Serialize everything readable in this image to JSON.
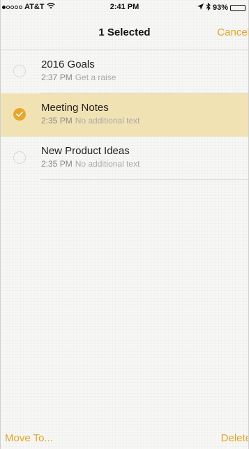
{
  "status_bar": {
    "carrier": "AT&T",
    "time": "2:41 PM",
    "battery": "93%",
    "signal_bars_filled": 1,
    "signal_bars_total": 5,
    "battery_level": 0.93
  },
  "nav": {
    "title": "1 Selected",
    "cancel_label": "Cancel"
  },
  "notes": [
    {
      "title": "2016 Goals",
      "time": "2:37 PM",
      "preview": "Get a raise",
      "selected": false
    },
    {
      "title": "Meeting Notes",
      "time": "2:35 PM",
      "preview": "No additional text",
      "selected": true
    },
    {
      "title": "New Product Ideas",
      "time": "2:35 PM",
      "preview": "No additional text",
      "selected": false
    }
  ],
  "toolbar": {
    "move_label": "Move To...",
    "delete_label": "Delete"
  },
  "colors": {
    "accent": "#e4a321",
    "selected_row": "#f1e2b4",
    "check_fill": "#e8a72c"
  }
}
